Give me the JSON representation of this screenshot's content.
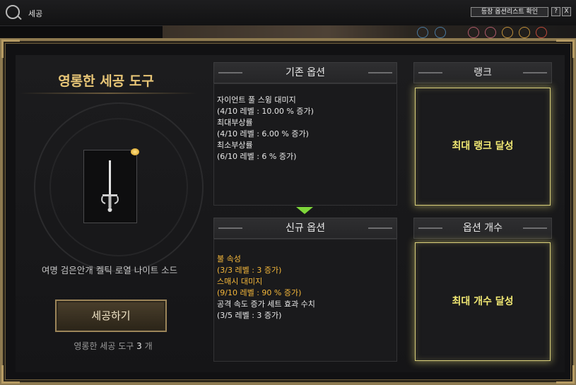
{
  "window": {
    "title": "세공",
    "option_list_button": "등장 옵션리스트 확인",
    "help_label": "?",
    "close_label": "X"
  },
  "left": {
    "tool_title": "영롱한 세공 도구",
    "item_name": "여명 검은안개 켈틱 로열 나이트 소드",
    "action_button": "세공하기",
    "tool_count_prefix": "영롱한 세공 도구",
    "tool_count": "3",
    "tool_count_suffix": "개"
  },
  "existing_options": {
    "header": "기존 옵션",
    "lines": [
      "자이언트 풀 스윙 대미지",
      "(4/10 레벨 : 10.00 % 증가)",
      "최대부상률",
      "(4/10 레벨 : 6.00 % 증가)",
      "최소부상률",
      "(6/10 레벨 : 6 % 증가)"
    ]
  },
  "new_options": {
    "header": "신규 옵션",
    "lines": [
      {
        "text": "불 속성",
        "highlight": true
      },
      {
        "text": "(3/3 레벨 : 3 증가)",
        "highlight": true
      },
      {
        "text": "스매시 대미지",
        "highlight": true
      },
      {
        "text": "(9/10 레벨 : 90 % 증가)",
        "highlight": true
      },
      {
        "text": "공격 속도 증가 세트 효과 수치",
        "highlight": false
      },
      {
        "text": "(3/5 레벨 : 3 증가)",
        "highlight": false
      }
    ]
  },
  "rank": {
    "header": "랭크",
    "status": "최대 랭크 달성"
  },
  "option_count": {
    "header": "옵션 개수",
    "status": "최대 개수 달성"
  },
  "colors": {
    "accent_gold": "#e8c677",
    "new_option_orange": "#f4b73a",
    "status_yellow": "#f1e873",
    "arrow_green": "#7ed63a"
  }
}
